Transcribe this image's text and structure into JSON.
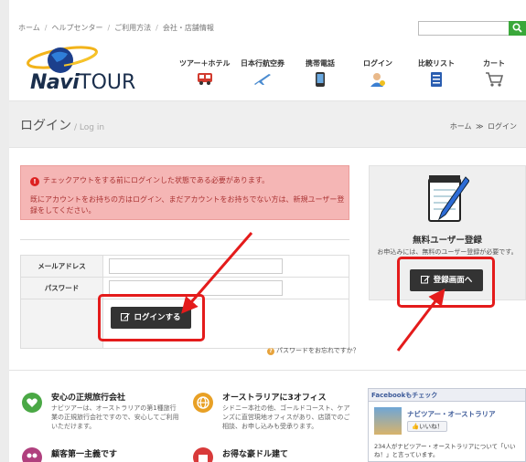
{
  "topbar": {
    "breadcrumbs": [
      "ホーム",
      "ヘルプセンター",
      "ご利用方法",
      "会社・店舗情報"
    ],
    "search_placeholder": ""
  },
  "logo": {
    "text_main": "Navi",
    "text_sub": "TOUR"
  },
  "nav": [
    {
      "label": "ツアー＋ホテル",
      "icon": "bus-icon"
    },
    {
      "label": "日本行航空券",
      "icon": "airplane-icon"
    },
    {
      "label": "携帯電話",
      "icon": "mobile-phone-icon"
    },
    {
      "label": "ログイン",
      "icon": "user-icon"
    },
    {
      "label": "比較リスト",
      "icon": "list-icon"
    },
    {
      "label": "カート",
      "icon": "cart-icon"
    }
  ],
  "page": {
    "title": "ログイン",
    "title_en": "/ Log in",
    "breadcrumb_home": "ホーム",
    "breadcrumb_current": "ログイン"
  },
  "alert": {
    "line1": "チェックアウトをする前にログインした状態である必要があります。",
    "line2": "既にアカウントをお持ちの方はログイン、まだアカウントをお持ちでない方は、新規ユーザー登録をしてください。"
  },
  "form": {
    "email_label": "メールアドレス",
    "email_value": "",
    "password_label": "パスワード",
    "password_value": "",
    "login_button": "ログインする",
    "forgot_link": "パスワードをお忘れですか？"
  },
  "register": {
    "title": "無料ユーザー登録",
    "desc": "お申込みには、無料のユーザー登録が必要です。",
    "button": "登録画面へ"
  },
  "features": [
    {
      "title": "安心の正規旅行会社",
      "desc": "ナビツアーは、オーストラリアの第1種旅行業の正規旅行会社ですので、安心してご利用いただけます。",
      "icon": "heart-icon",
      "color": "#4aa845"
    },
    {
      "title": "オーストラリアに3オフィス",
      "desc": "シドニー本社の他、ゴールドコースト、ケアンズに直営現地オフィスがあり、店頭でのご相談、お申し込みも受承ります。",
      "icon": "globe-icon",
      "color": "#e8a025"
    },
    {
      "title": "顧客第一主義です",
      "desc": "",
      "icon": "people-icon",
      "color": "#b0407e"
    },
    {
      "title": "お得な豪ドル建て",
      "desc": "",
      "icon": "gift-icon",
      "color": "#d83a3a"
    }
  ],
  "facebook": {
    "header": "Facebookもチェック",
    "page_name": "ナビツアー・オーストラリア",
    "like_button": "いいね！",
    "text": "234人がナビツアー・オーストラリアについて「いいね！」と言っています。"
  },
  "colors": {
    "accent_green": "#3aa83a",
    "alert_bg": "#f5b6b5",
    "button_dark": "#333333",
    "highlight_red": "#e41b1b"
  }
}
